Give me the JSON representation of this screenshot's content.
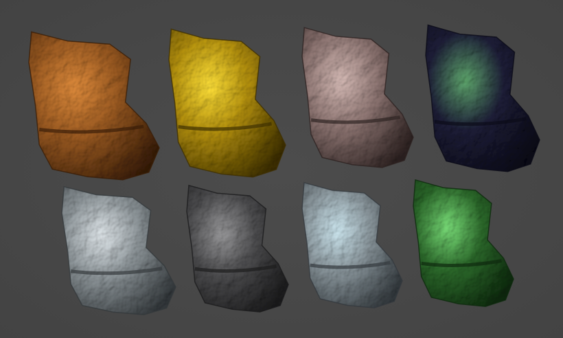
{
  "scene": {
    "background": "#474747",
    "ores": [
      {
        "material": "copper-ore",
        "base": "#9a5a22",
        "light": "#e08c3c",
        "dark": "#3a1e08"
      },
      {
        "material": "gold-ore",
        "base": "#b08d0c",
        "light": "#ffe13a",
        "dark": "#3e3002"
      },
      {
        "material": "rose-stone-ore",
        "base": "#8d7572",
        "light": "#d7bcb7",
        "dark": "#2e2322"
      },
      {
        "material": "dark-emerald-ore",
        "base": "#1e1e38",
        "light": "#5fa86e",
        "dark": "#0b0b18"
      },
      {
        "material": "silver-ore",
        "base": "#8c9498",
        "light": "#e1e8ec",
        "dark": "#34393c"
      },
      {
        "material": "iron-ore",
        "base": "#4c4c4e",
        "light": "#9a9a9c",
        "dark": "#1c1c1d"
      },
      {
        "material": "mithril-ore",
        "base": "#8a969c",
        "light": "#cfe9f2",
        "dark": "#343a3e"
      },
      {
        "material": "emerald-ore",
        "base": "#2d6a2c",
        "light": "#7be07a",
        "dark": "#0e2a0e"
      }
    ]
  }
}
